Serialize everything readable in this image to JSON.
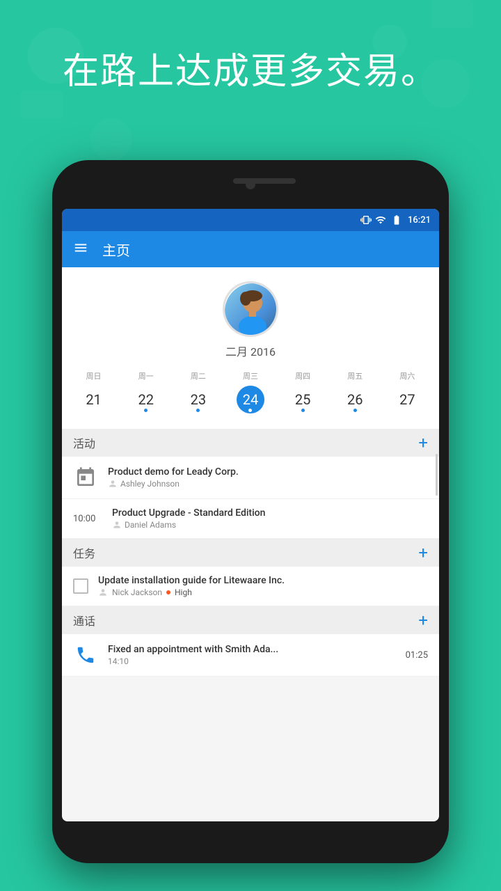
{
  "background": {
    "headline": "在路上达成更多交易。"
  },
  "statusBar": {
    "time": "16:21"
  },
  "appBar": {
    "title": "主页"
  },
  "profile": {
    "month": "二月 2016"
  },
  "calendar": {
    "dayHeaders": [
      "周日",
      "周一",
      "周二",
      "周三",
      "周四",
      "周五",
      "周六"
    ],
    "days": [
      {
        "number": "21",
        "hasDot": false,
        "selected": false
      },
      {
        "number": "22",
        "hasDot": true,
        "selected": false
      },
      {
        "number": "23",
        "hasDot": true,
        "selected": false
      },
      {
        "number": "24",
        "hasDot": true,
        "selected": true
      },
      {
        "number": "25",
        "hasDot": true,
        "selected": false
      },
      {
        "number": "26",
        "hasDot": true,
        "selected": false
      },
      {
        "number": "27",
        "hasDot": false,
        "selected": false
      }
    ]
  },
  "sections": {
    "activities": "活动",
    "tasks": "任务",
    "calls": "通话"
  },
  "activityItems": [
    {
      "id": 1,
      "time": "",
      "title": "Product demo for Leady Corp.",
      "person": "Ashley Johnson",
      "hasCalIcon": true
    },
    {
      "id": 2,
      "time": "10:00",
      "title": "Product Upgrade - Standard Edition",
      "person": "Daniel Adams",
      "hasCalIcon": false
    }
  ],
  "taskItems": [
    {
      "id": 1,
      "title": "Update installation guide for Litewaare Inc.",
      "person": "Nick Jackson",
      "priority": "High"
    }
  ],
  "callItems": [
    {
      "id": 1,
      "title": "Fixed an appointment with Smith Ada...",
      "time": "14:10",
      "duration": "01:25"
    }
  ]
}
